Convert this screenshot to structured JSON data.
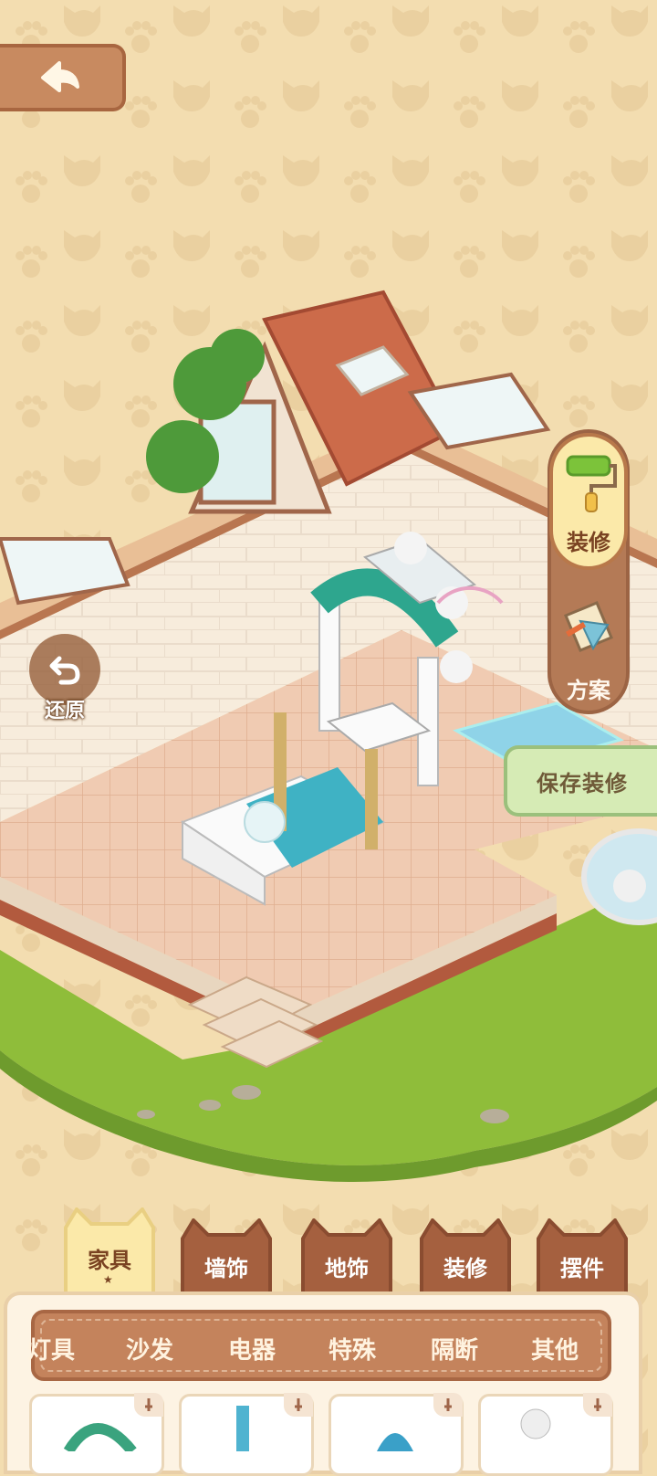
{
  "side_menu": {
    "decorate_label": "装修",
    "plan_label": "方案"
  },
  "restore": {
    "label": "还原"
  },
  "save": {
    "label": "保存装修"
  },
  "categories": [
    {
      "label": "家具",
      "active": true
    },
    {
      "label": "墙饰",
      "active": false
    },
    {
      "label": "地饰",
      "active": false
    },
    {
      "label": "装修",
      "active": false
    },
    {
      "label": "摆件",
      "active": false
    }
  ],
  "subcategories": [
    "灯具",
    "沙发",
    "电器",
    "特殊",
    "隔断",
    "其他"
  ],
  "colors": {
    "accent": "#c4835c",
    "background": "#f3ddb0",
    "grass": "#8fbd3a"
  }
}
